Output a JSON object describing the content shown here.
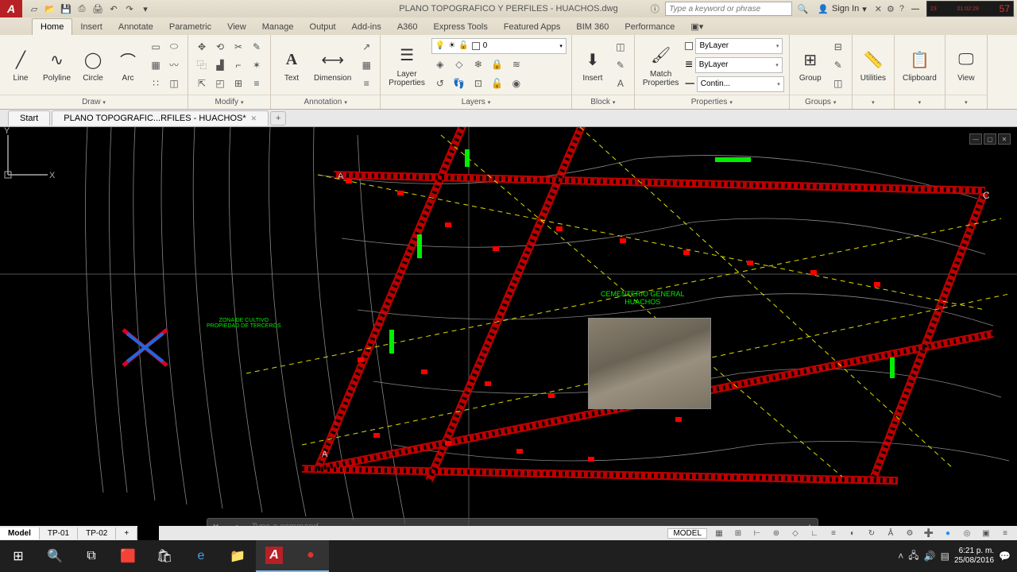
{
  "title": "PLANO TOPOGRAFICO Y PERFILES - HUACHOS.dwg",
  "search_placeholder": "Type a keyword or phrase",
  "signin": "Sign In",
  "ribbon_tabs": [
    "Home",
    "Insert",
    "Annotate",
    "Parametric",
    "View",
    "Manage",
    "Output",
    "Add-ins",
    "A360",
    "Express Tools",
    "Featured Apps",
    "BIM 360",
    "Performance"
  ],
  "draw": {
    "line": "Line",
    "polyline": "Polyline",
    "circle": "Circle",
    "arc": "Arc",
    "title": "Draw"
  },
  "modify": {
    "title": "Modify"
  },
  "annotation": {
    "text": "Text",
    "dimension": "Dimension",
    "title": "Annotation"
  },
  "layers": {
    "props": "Layer\nProperties",
    "current": "0",
    "title": "Layers"
  },
  "block": {
    "insert": "Insert",
    "match": "Match\nProperties",
    "title": "Block"
  },
  "properties": {
    "bylayer": "ByLayer",
    "bylayer2": "ByLayer",
    "contin": "Contin...",
    "title": "Properties"
  },
  "groups": {
    "group": "Group",
    "title": "Groups"
  },
  "utilities": {
    "label": "Utilities"
  },
  "clipboard": {
    "label": "Clipboard"
  },
  "view": {
    "label": "View"
  },
  "file_tabs": {
    "start": "Start",
    "doc": "PLANO TOPOGRAFIC...RFILES - HUACHOS*"
  },
  "drawing": {
    "label1": "CEMENTERIO GENERAL",
    "label2": "HUACHOS",
    "label3": "ZONA DE CULTIVO\nPROPIEDAD DE TERCEROS"
  },
  "cmd_placeholder": "Type a command",
  "model_tabs": {
    "model": "Model",
    "t1": "TP-01",
    "t2": "TP-02"
  },
  "status_model": "MODEL",
  "taskbar": {
    "time": "6:21 p. m.",
    "date": "25/08/2016"
  },
  "clock": {
    "d": "23",
    "t": "01:02:28",
    "s": "57"
  }
}
